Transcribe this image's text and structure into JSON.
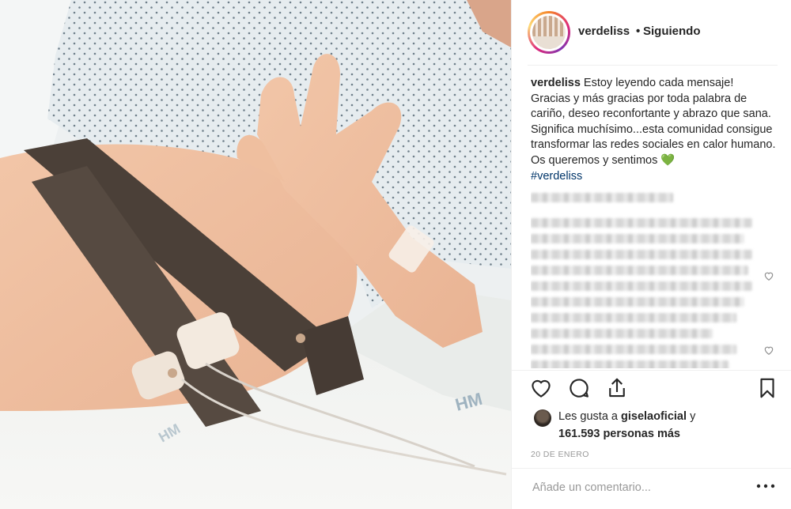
{
  "post": {
    "username": "verdeliss",
    "separator": "•",
    "follow_status": "Siguiendo",
    "caption": {
      "username": "verdeliss",
      "text": "Estoy leyendo cada mensaje! Gracias y más gracias por toda palabra de cariño, deseo reconfortante y abrazo que sana. Significa muchísimo...esta comunidad consigue transformar las redes sociales en calor humano. Os queremos y sentimos",
      "emoji": "💚",
      "hashtag": "#verdeliss"
    },
    "likes": {
      "prefix": "Les gusta a",
      "liker": "giselaoficial",
      "conjunction": "y",
      "others": "161.593 personas más"
    },
    "date": "20 DE ENERO",
    "comment_placeholder": "Añade un comentario...",
    "more_label": "•••"
  },
  "icons": {
    "like": "heart-outline-icon",
    "comment": "speech-bubble-icon",
    "share": "share-arrow-icon",
    "save": "bookmark-icon",
    "comment_like": "small-heart-icon",
    "more": "more-dots-icon"
  },
  "colors": {
    "text": "#262626",
    "muted": "#999999",
    "hashtag": "#003569",
    "emoji_green": "#2ec24b",
    "divider": "#efefef"
  }
}
